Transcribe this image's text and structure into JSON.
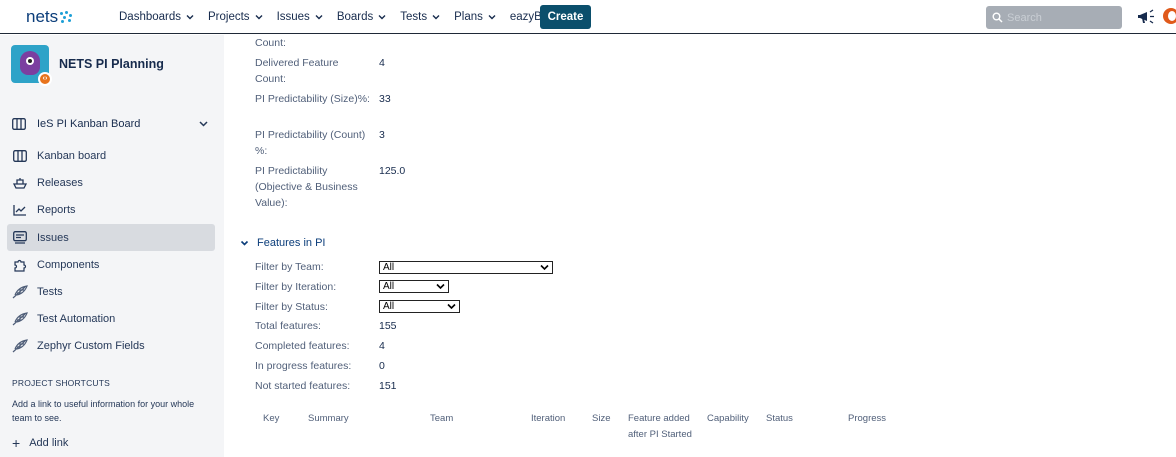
{
  "topbar": {
    "logo": "nets",
    "nav": [
      "Dashboards",
      "Projects",
      "Issues",
      "Boards",
      "Tests",
      "Plans",
      "eazyBI"
    ],
    "create_label": "Create",
    "search_placeholder": "Search",
    "brand_color": "#0b4f6c"
  },
  "sidebar": {
    "project_name": "NETS PI Planning",
    "board_selector": "IeS PI Kanban Board",
    "items": [
      {
        "label": "Kanban board",
        "icon": "kanban-icon"
      },
      {
        "label": "Releases",
        "icon": "ship-icon"
      },
      {
        "label": "Reports",
        "icon": "chart-icon"
      },
      {
        "label": "Issues",
        "icon": "issues-icon",
        "active": true
      },
      {
        "label": "Components",
        "icon": "puzzle-icon"
      },
      {
        "label": "Tests",
        "icon": "feather-icon"
      },
      {
        "label": "Test Automation",
        "icon": "feather-icon"
      },
      {
        "label": "Zephyr Custom Fields",
        "icon": "feather-icon"
      }
    ],
    "shortcuts_title": "PROJECT SHORTCUTS",
    "shortcuts_desc": "Add a link to useful information for your whole team to see.",
    "add_link": "Add link"
  },
  "details": [
    {
      "label": "Count:",
      "value": ""
    },
    {
      "label": "Delivered Feature Count:",
      "value": "4"
    },
    {
      "label": "PI Predictability (Size)%:",
      "value": "33"
    },
    {
      "label": "PI Predictability (Count) %:",
      "value": "3"
    },
    {
      "label": "PI Predictability (Objective & Business Value):",
      "value": "125.0"
    }
  ],
  "features": {
    "section_title": "Features in PI",
    "filters": [
      {
        "label": "Filter by Team:",
        "value": "All"
      },
      {
        "label": "Filter by Iteration:",
        "value": "All"
      },
      {
        "label": "Filter by Status:",
        "value": "All"
      }
    ],
    "stats": [
      {
        "label": "Total features:",
        "value": "155"
      },
      {
        "label": "Completed features:",
        "value": "4"
      },
      {
        "label": "In progress features:",
        "value": "0"
      },
      {
        "label": "Not started features:",
        "value": "151"
      }
    ],
    "columns": [
      "Key",
      "Summary",
      "Team",
      "Iteration",
      "Size",
      "Feature added after PI Started",
      "Capability",
      "Status",
      "Progress"
    ]
  }
}
